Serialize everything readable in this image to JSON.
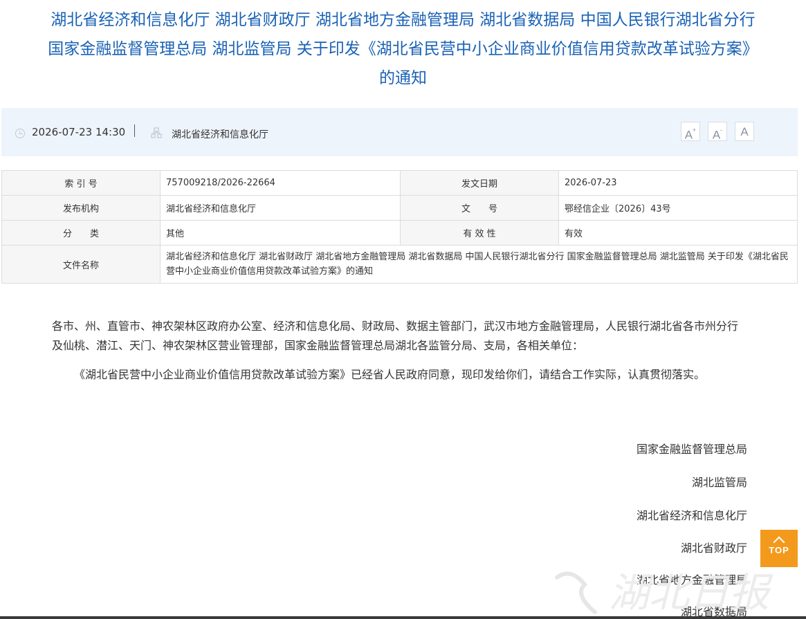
{
  "title": {
    "line1": "湖北省经济和信息化厅 湖北省财政厅 湖北省地方金融管理局 湖北省数据局 中国人民银行湖北省分行",
    "line2": "国家金融监督管理总局 湖北监管局 关于印发《湖北省民营中小企业商业价值信用贷款改革试验方案》",
    "line3": "的通知"
  },
  "infobar": {
    "datetime": "2026-07-23 14:30",
    "source": "湖北省经济和信息化厅",
    "font_buttons": [
      "A+",
      "A-",
      "A"
    ]
  },
  "meta": {
    "index_label": "索 引 号",
    "index_value": "757009218/2026-22664",
    "date_label": "发文日期",
    "date_value": "2026-07-23",
    "issuer_label": "发布机构",
    "issuer_value": "湖北省经济和信息化厅",
    "docno_label": "文　　号",
    "docno_value": "鄂经信企业〔2026〕43号",
    "category_label": "分　　类",
    "category_value": "其他",
    "validity_label": "有 效 性",
    "validity_value": "有效",
    "filename_label": "文件名称",
    "filename_value": "湖北省经济和信息化厅 湖北省财政厅 湖北省地方金融管理局 湖北省数据局 中国人民银行湖北省分行 国家金融监督管理总局 湖北监管局 关于印发《湖北省民营中小企业商业价值信用贷款改革试验方案》的通知"
  },
  "body": {
    "addressee": "各市、州、直管市、神农架林区政府办公室、经济和信息化局、财政局、数据主管部门，武汉市地方金融管理局，人民银行湖北省各市州分行及仙桃、潜江、天门、神农架林区营业管理部，国家金融监督管理总局湖北各监管分局、支局，各相关单位：",
    "paragraph": "《湖北省民营中小企业商业价值信用贷款改革试验方案》已经省人民政府同意，现印发给你们，请结合工作实际，认真贯彻落实。"
  },
  "signatures": [
    "国家金融监督管理总局",
    "湖北监管局",
    "湖北省经济和信息化厅",
    "湖北省财政厅",
    "湖北省地方金融管理局",
    "湖北省数据局"
  ],
  "top_button": "TOP",
  "watermark": "湖北日报",
  "colors": {
    "title": "#1a62b5",
    "infobar_bg": "#eef4fb",
    "top_button": "#f39a1d"
  }
}
